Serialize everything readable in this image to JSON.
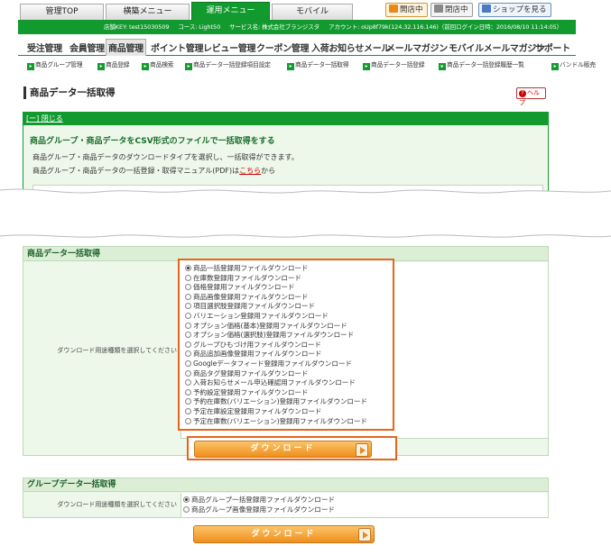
{
  "top_tabs": [
    "管理TOP",
    "横築メニュー",
    "運用メニュー",
    "モバイル"
  ],
  "top_buttons": {
    "open_store": "開店中",
    "close_store": "閉店中",
    "view_shop": "ショップを見る"
  },
  "info_bar": {
    "store_key": "店舗KEY: test15030509",
    "course": "コース: Light50",
    "service": "サービス名: 株式会社ブランジスタ",
    "account": "アカウント: oUp8f79k(124.32.116.146)（前回ログイン日時：2016/08/10 11:14:05）"
  },
  "main_menu": [
    "受注管理",
    "会員管理",
    "商品管理",
    "ポイント管理",
    "レビュー管理",
    "クーポン管理",
    "入荷お知らせメール",
    "メールマガジン",
    "モバイルメールマガジン",
    "サポート"
  ],
  "sub_menu": [
    "商品グループ管理",
    "商品登録",
    "商品検索",
    "商品データ一括登録項目設定",
    "商品データ一括取得",
    "商品データ一括登録",
    "商品データ一括登録履歴一覧",
    "バンドル販売"
  ],
  "page_title": "商品データ一括取得",
  "help_label": "ヘルプ",
  "desc": {
    "close_link": "[ー] 閉じる",
    "title": "商品グループ・商品データをCSV形式のファイルで一括取得をする",
    "text1": "商品グループ・商品データのダウンロードタイプを選択し、一括取得ができます。",
    "text2_before": "商品グループ・商品データの一括登録・取得マニュアル(PDF)は",
    "text2_link": "こちら",
    "text2_after": "から"
  },
  "product_section": {
    "title": "商品データ一括取得",
    "label": "ダウンロード用途種類を選択してください",
    "options": [
      "商品一括登録用ファイルダウンロード",
      "在庫数登録用ファイルダウンロード",
      "価格登録用ファイルダウンロード",
      "商品画像登録用ファイルダウンロード",
      "項目選択肢登録用ファイルダウンロード",
      "バリエーション登録用ファイルダウンロード",
      "オプション価格(基本)登録用ファイルダウンロード",
      "オプション価格(選択肢)登録用ファイルダウンロード",
      "グループひもづけ用ファイルダウンロード",
      "商品追加画像登録用ファイルダウンロード",
      "Googleデータフィード登録用ファイルダウンロード",
      "商品タグ登録用ファイルダウンロード",
      "入荷お知らせメール申込確認用ファイルダウンロード",
      "予約設定登録用ファイルダウンロード",
      "予約在庫数(バリエーション)登録用ファイルダウンロード",
      "予定在庫設定登録用ファイルダウンロード",
      "予定在庫数(バリエーション)登録用ファイルダウンロード"
    ],
    "selected_index": 0,
    "download_label": "ダウンロード"
  },
  "group_section": {
    "title": "グループデータ一括取得",
    "label": "ダウンロード用途種類を選択してください",
    "options": [
      "商品グループ一括登録用ファイルダウンロード",
      "商品グループ画像登録用ファイルダウンロード"
    ],
    "selected_index": 0,
    "download_label": "ダウンロード"
  },
  "colors": {
    "green": "#129a2f",
    "orange": "#e8641b"
  }
}
